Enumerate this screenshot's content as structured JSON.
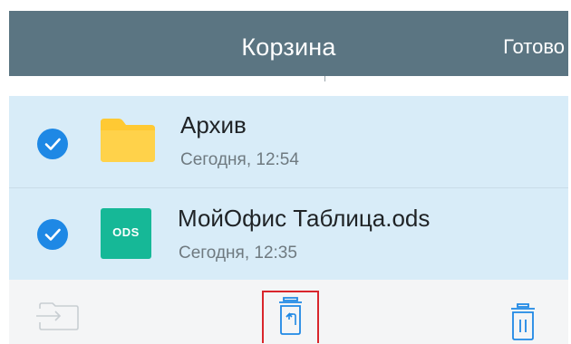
{
  "navbar": {
    "title": "Корзина",
    "done_label": "Готово"
  },
  "files": [
    {
      "name": "Архив",
      "date": "Сегодня, 12:54",
      "type_icon": "folder-icon",
      "selected": true
    },
    {
      "name": "МойОфис Таблица.ods",
      "date": "Сегодня, 12:35",
      "type_icon": "ods-file-icon",
      "type_label": "ODS",
      "selected": true
    }
  ],
  "toolbar": {
    "items": [
      {
        "icon": "move-to-folder-icon",
        "enabled": false
      },
      {
        "icon": "restore-icon",
        "enabled": true,
        "highlighted": true
      },
      {
        "icon": "delete-icon",
        "enabled": true
      }
    ]
  },
  "colors": {
    "navbar_bg": "#5b7582",
    "selected_row_bg": "#d8ecf8",
    "accent_blue": "#1e88e5",
    "ods_green": "#16b897",
    "folder_yellow": "#ffc933",
    "highlight_red": "#d9262c"
  }
}
